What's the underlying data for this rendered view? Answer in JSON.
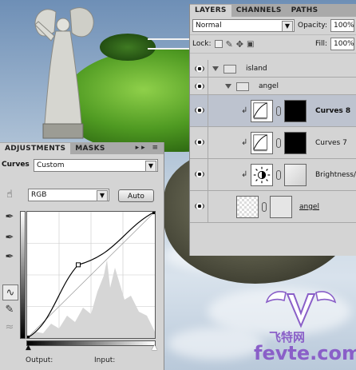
{
  "layers_panel": {
    "tabs": [
      "LAYERS",
      "CHANNELS",
      "PATHS"
    ],
    "blend_mode": "Normal",
    "opacity_label": "Opacity:",
    "opacity_value": "100%",
    "lock_label": "Lock:",
    "fill_label": "Fill:",
    "fill_value": "100%",
    "layers": [
      {
        "name": "island",
        "type": "group",
        "indent": 0,
        "expanded": true,
        "selected": false
      },
      {
        "name": "angel",
        "type": "group",
        "indent": 1,
        "expanded": true,
        "selected": false
      },
      {
        "name": "Curves 8",
        "type": "curves-adjustment",
        "clipped": true,
        "selected": true
      },
      {
        "name": "Curves 7",
        "type": "curves-adjustment",
        "clipped": true,
        "selected": false
      },
      {
        "name": "Brightness/",
        "type": "brightness-adjustment",
        "clipped": true,
        "selected": false
      },
      {
        "name": "angel",
        "type": "smart-layer",
        "selected": false
      }
    ]
  },
  "adjustments_panel": {
    "tabs": [
      "ADJUSTMENTS",
      "MASKS"
    ],
    "adjustment_name": "Curves",
    "preset_value": "Custom",
    "channel_value": "RGB",
    "auto_button": "Auto",
    "output_label": "Output:",
    "input_label": "Input:",
    "curve_points": [
      [
        0,
        0
      ],
      [
        0.4,
        0.58
      ],
      [
        1,
        1
      ]
    ]
  },
  "watermark": {
    "cn_text": "飞特网",
    "url_text": "fevte.com",
    "brand_color": "#8a5fc8"
  },
  "icons": [
    "eye-icon",
    "folder-icon",
    "chain-link-icon",
    "curves-thumbnail-icon",
    "brightness-icon",
    "hand-adjust-icon",
    "eyedropper-icon",
    "pencil-icon",
    "smooth-icon"
  ]
}
